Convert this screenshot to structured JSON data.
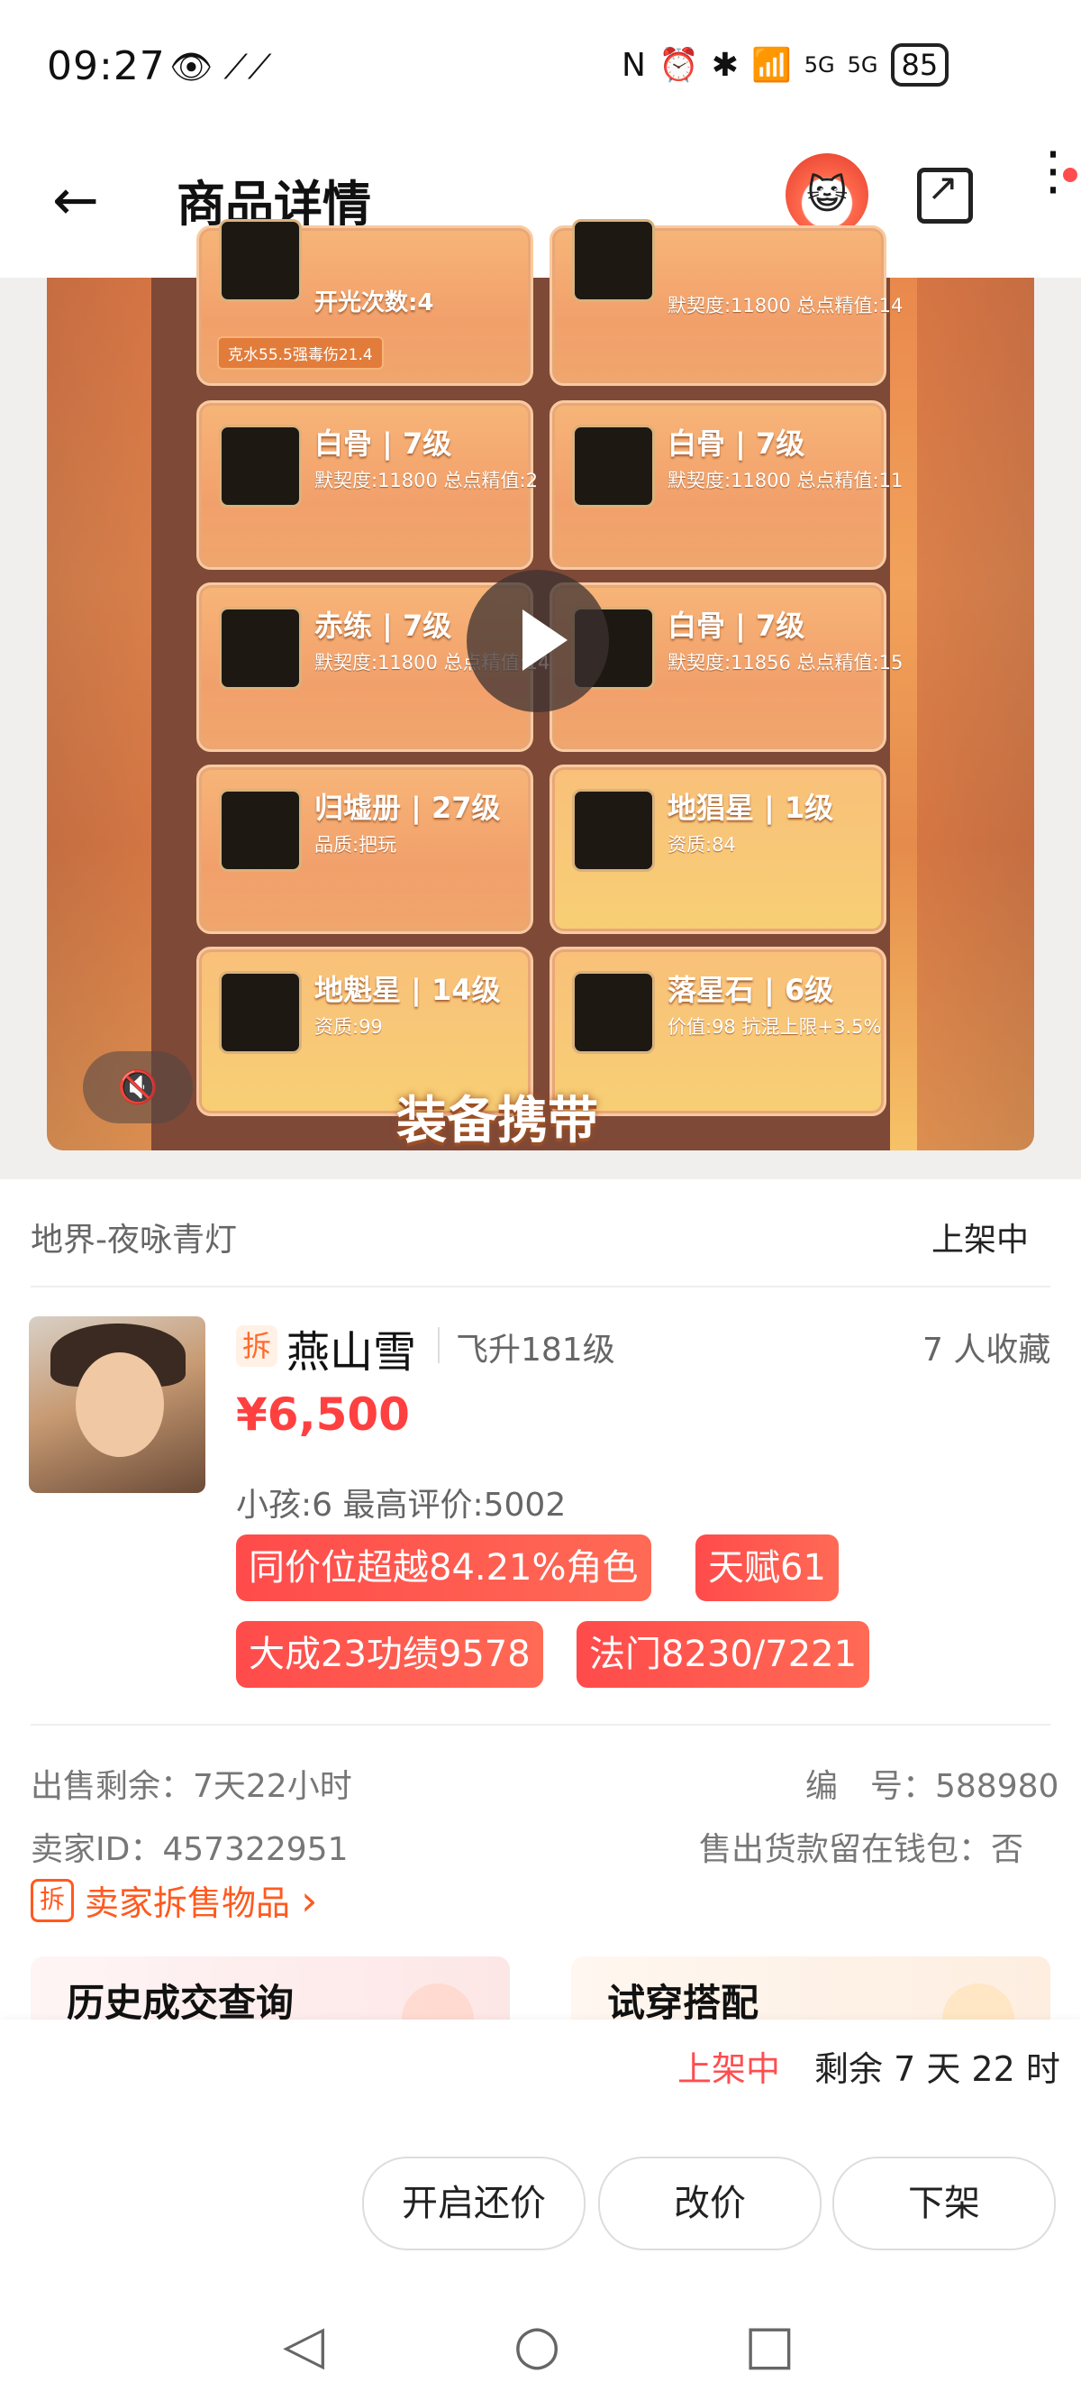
{
  "status_bar": {
    "time": "09:27",
    "left_icons": "👁 ⟋⟋",
    "right_icons": [
      "N",
      "⏰",
      "✱",
      "📶",
      "5G",
      "5G"
    ],
    "battery": "85"
  },
  "header": {
    "title": "商品详情",
    "back_icon": "←",
    "mascot_icon": "😺",
    "more_icon": "⋮"
  },
  "video": {
    "cards": [
      {
        "name": "开光次数:4",
        "sub": "",
        "tag": "克水55.5强毒伤21.4"
      },
      {
        "name": "",
        "sub": "默契度:11800 总点精值:14",
        "tag": ""
      },
      {
        "name": "白骨 | 7级",
        "sub": "默契度:11800 总点精值:2",
        "tag": ""
      },
      {
        "name": "白骨 | 7级",
        "sub": "默契度:11800 总点精值:11",
        "tag": ""
      },
      {
        "name": "赤练 | 7级",
        "sub": "默契度:11800 总点精值:14",
        "tag": ""
      },
      {
        "name": "白骨 | 7级",
        "sub": "默契度:11856 总点精值:15",
        "tag": ""
      },
      {
        "name": "归墟册 | 27级",
        "sub": "品质:把玩",
        "tag": ""
      },
      {
        "name": "地猖星 | 1级",
        "sub": "资质:84",
        "tag": ""
      },
      {
        "name": "地魁星 | 14级",
        "sub": "资质:99",
        "tag": ""
      },
      {
        "name": "落星石 | 6级",
        "sub": "价值:98 抗混上限+3.5%",
        "tag": ""
      }
    ],
    "banner": "装备携带",
    "mute_icon": "🔇"
  },
  "item": {
    "server": "地界-夜咏青灯",
    "state": "上架中",
    "badge": "拆",
    "name": "燕山雪",
    "level": "飞升181级",
    "favorites": "7 人收藏",
    "price": "¥6,500",
    "meta": "小孩:6 最高评价:5002",
    "tags": [
      "同价位超越84.21%角色",
      "天赋61",
      "大成23功绩9578",
      "法门8230/7221"
    ]
  },
  "details": {
    "remaining": "出售剩余：7天22小时",
    "number": "编　号：588980",
    "seller_id": "卖家ID：457322951",
    "wallet": "售出货款留在钱包：否",
    "split_link": "卖家拆售物品",
    "split_badge": "拆",
    "arrow": "›"
  },
  "panels": {
    "history": "历史成交查询",
    "tryon": "试穿搭配"
  },
  "bottom_bar": {
    "status": "上架中",
    "remaining": "剩余 7 天 22 时",
    "buttons": [
      "开启还价",
      "改价",
      "下架"
    ]
  },
  "nav": {
    "back": "◁",
    "home": "○",
    "recent": "□"
  }
}
